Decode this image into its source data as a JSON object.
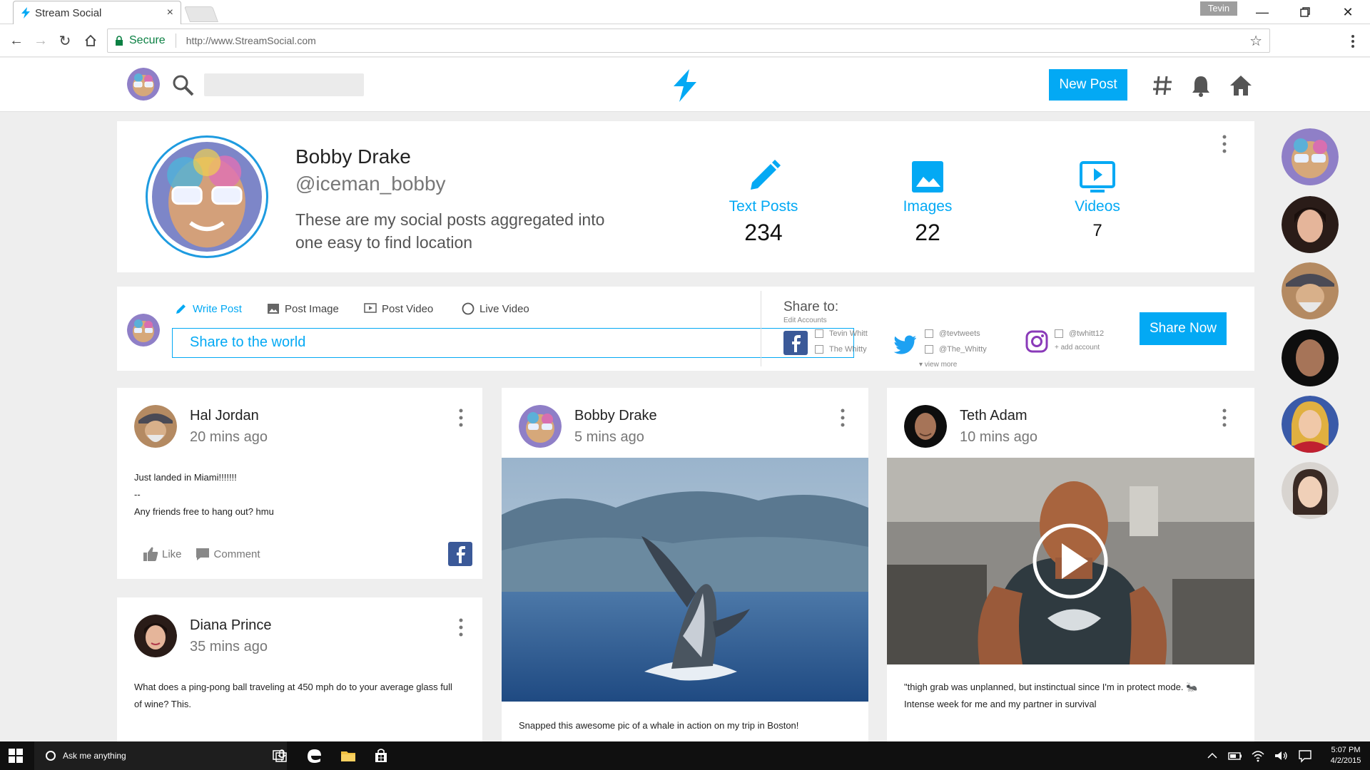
{
  "browser": {
    "tab_title": "Stream Social",
    "tab_close": "×",
    "user_chip": "Tevin",
    "secure_label": "Secure",
    "url": "http://www.StreamSocial.com"
  },
  "header": {
    "search_placeholder": "",
    "new_post_label": "New Post"
  },
  "profile": {
    "name": "Bobby Drake",
    "handle": "@iceman_bobby",
    "bio": "These are my social posts aggregated into one easy to find location",
    "stats": [
      {
        "label": "Text Posts",
        "value": "234"
      },
      {
        "label": "Images",
        "value": "22"
      },
      {
        "label": "Videos",
        "value": "7"
      }
    ]
  },
  "composer": {
    "tabs": [
      "Write Post",
      "Post Image",
      "Post Video",
      "Live Video"
    ],
    "input_text": "Share to the world",
    "share_to": "Share to:",
    "edit_accounts": "Edit Accounts",
    "facebook_accounts": [
      "Tevin Whitt",
      "The Whitty"
    ],
    "twitter_accounts": [
      "@tevtweets",
      "@The_Whitty"
    ],
    "instagram_accounts": [
      "@twhitt12"
    ],
    "view_more": "▾ view more",
    "add_account": "+ add account",
    "share_now": "Share Now"
  },
  "posts": [
    {
      "author": "Hal Jordan",
      "time": "20 mins ago",
      "lines": [
        "Just landed in Miami!!!!!!!",
        "--",
        "Any friends free to hang out? hmu"
      ],
      "like": "Like",
      "comment": "Comment"
    },
    {
      "author": "Diana Prince",
      "time": "35 mins ago",
      "lines": [
        "What does a ping-pong ball traveling at 450 mph do to your average glass full",
        "of wine? This."
      ]
    },
    {
      "author": "Bobby Drake",
      "time": "5 mins ago",
      "lines": [
        "Snapped this awesome pic of a whale in action on my trip in Boston!"
      ]
    },
    {
      "author": "Teth Adam",
      "time": "10 mins ago",
      "lines": [
        "\"thigh grab was unplanned, but instinctual since I'm in protect mode. 🐜",
        "Intense week for me and my partner in survival"
      ]
    }
  ],
  "taskbar": {
    "search_text": "Ask me anything",
    "time": "5:07 PM",
    "date": "4/2/2015"
  },
  "colors": {
    "accent": "#03a9f4",
    "facebook": "#3b5998",
    "twitter": "#1da1f2",
    "instagram": "#8a3ab9"
  }
}
